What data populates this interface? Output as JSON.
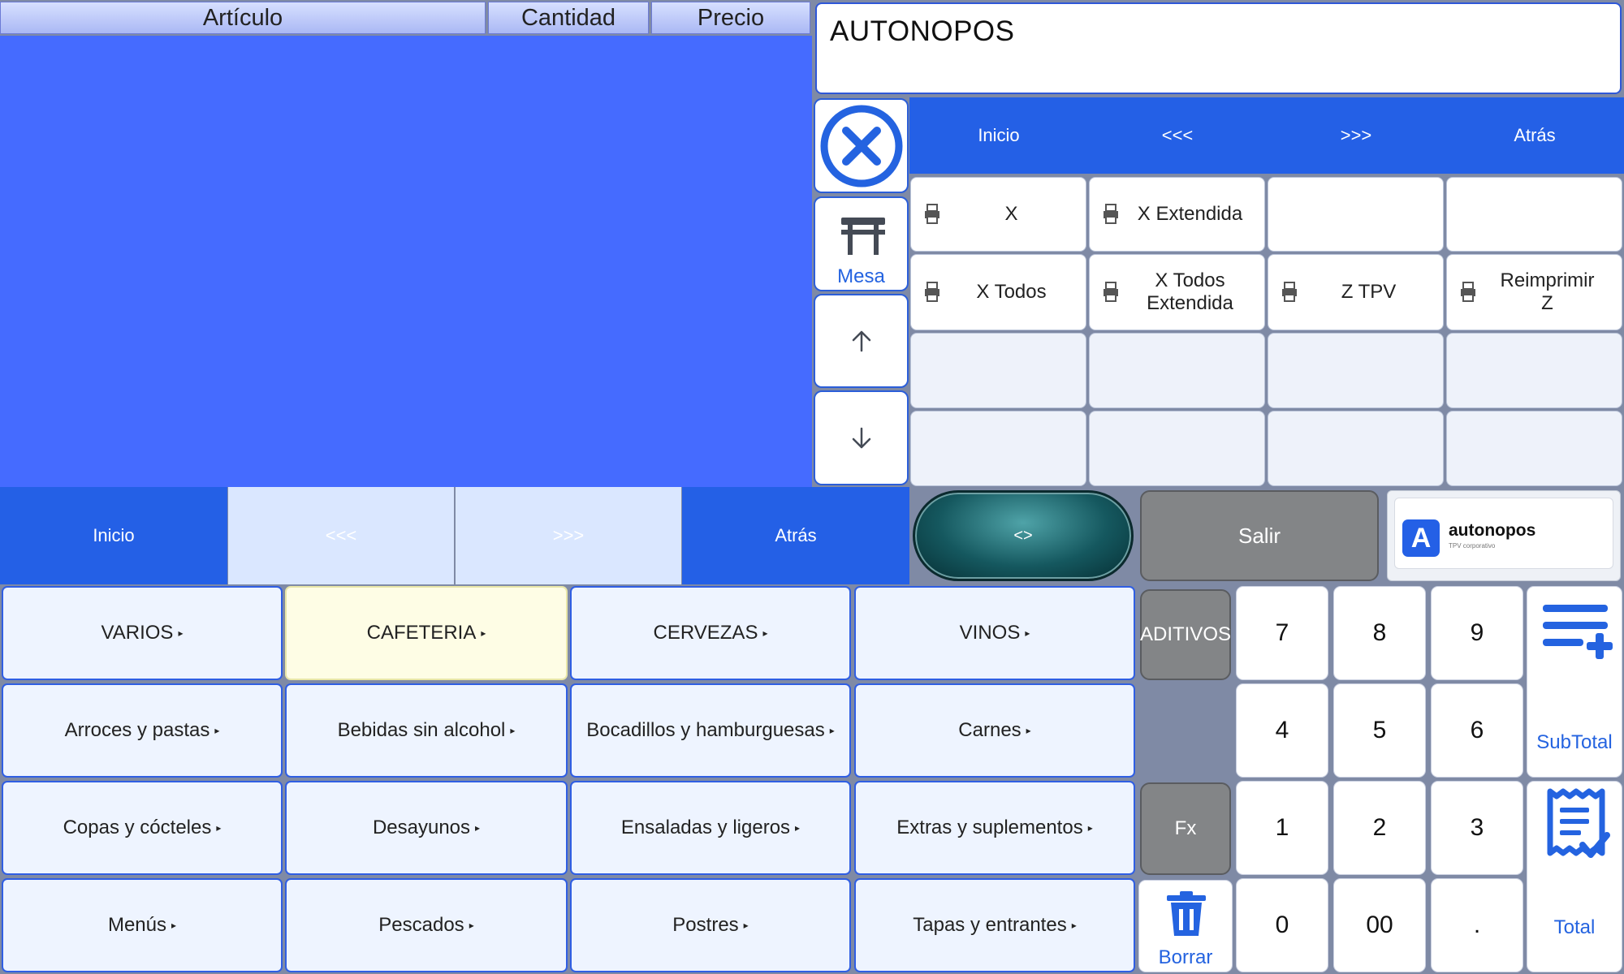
{
  "table_header": {
    "col_article": "Artículo",
    "col_qty": "Cantidad",
    "col_price": "Precio"
  },
  "info": {
    "title": "AUTONOPOS"
  },
  "side": {
    "mesa_label": "Mesa"
  },
  "top_nav": {
    "inicio": "Inicio",
    "prev": "<<<",
    "next": ">>>",
    "atras": "Atrás"
  },
  "functions": [
    {
      "label": "X"
    },
    {
      "label": "X Extendida"
    },
    {
      "label": ""
    },
    {
      "label": ""
    },
    {
      "label": "X Todos"
    },
    {
      "label": "X Todos Extendida"
    },
    {
      "label": "Z TPV"
    },
    {
      "label": "Reimprimir Z"
    }
  ],
  "bottom_nav": {
    "inicio": "Inicio",
    "prev": "<<<",
    "next": ">>>",
    "atras": "Atrás"
  },
  "controls": {
    "toggle": "<>",
    "salir": "Salir"
  },
  "logo": {
    "name": "autonopos",
    "tagline": "TPV corporativo",
    "letter": "A"
  },
  "categories": [
    "VARIOS",
    "CAFETERIA",
    "CERVEZAS",
    "VINOS",
    "Arroces y pastas",
    "Bebidas sin alcohol",
    "Bocadillos y hamburguesas",
    "Carnes",
    "Copas y cócteles",
    "Desayunos",
    "Ensaladas y ligeros",
    "Extras y suplementos",
    "Menús",
    "Pescados",
    "Postres",
    "Tapas y entrantes"
  ],
  "keypad": {
    "aditivos": "ADITIVOS",
    "fx": "Fx",
    "borrar": "Borrar",
    "keys": [
      "7",
      "8",
      "9",
      "4",
      "5",
      "6",
      "1",
      "2",
      "3",
      "0",
      "00",
      "."
    ],
    "subtotal": "SubTotal",
    "total": "Total"
  },
  "colors": {
    "accent": "#2460e6",
    "ticket_bg": "#456bff",
    "selected_category": "#fefde5"
  }
}
